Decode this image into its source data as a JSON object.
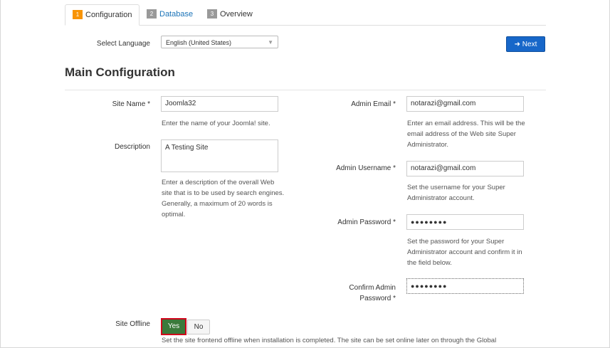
{
  "tabs": [
    {
      "number": "1",
      "label": "Configuration"
    },
    {
      "number": "2",
      "label": "Database"
    },
    {
      "number": "3",
      "label": "Overview"
    }
  ],
  "language": {
    "label": "Select Language",
    "value": "English (United States)"
  },
  "next_button": {
    "label": "Next",
    "icon": "arrow-right-icon"
  },
  "heading": "Main Configuration",
  "site_name": {
    "label": "Site Name *",
    "value": "Joomla32",
    "help": "Enter the name of your Joomla! site."
  },
  "description": {
    "label": "Description",
    "value": "A Testing Site",
    "help": [
      "Enter a description of the overall Web",
      "site that is to be used by search engines.",
      "Generally, a maximum of 20 words is",
      "optimal."
    ]
  },
  "admin_email": {
    "label": "Admin Email *",
    "value": "notarazi@gmail.com",
    "help": [
      "Enter an email address. This will be the",
      "email address of the Web site Super",
      "Administrator."
    ]
  },
  "admin_username": {
    "label": "Admin Username *",
    "value": "notarazi@gmail.com",
    "help": [
      "Set the username for your Super",
      "Administrator account."
    ]
  },
  "admin_password": {
    "label": "Admin Password *",
    "value": "●●●●●●●●",
    "help": [
      "Set the password for your Super",
      "Administrator account and confirm it in",
      "the field below."
    ]
  },
  "confirm_password": {
    "label_line1": "Confirm Admin",
    "label_line2": "Password *",
    "value": "●●●●●●●●"
  },
  "site_offline": {
    "label": "Site Offline",
    "yes": "Yes",
    "no": "No",
    "help": "Set the site frontend offline when installation is completed. The site can be set online later on through the Global"
  }
}
